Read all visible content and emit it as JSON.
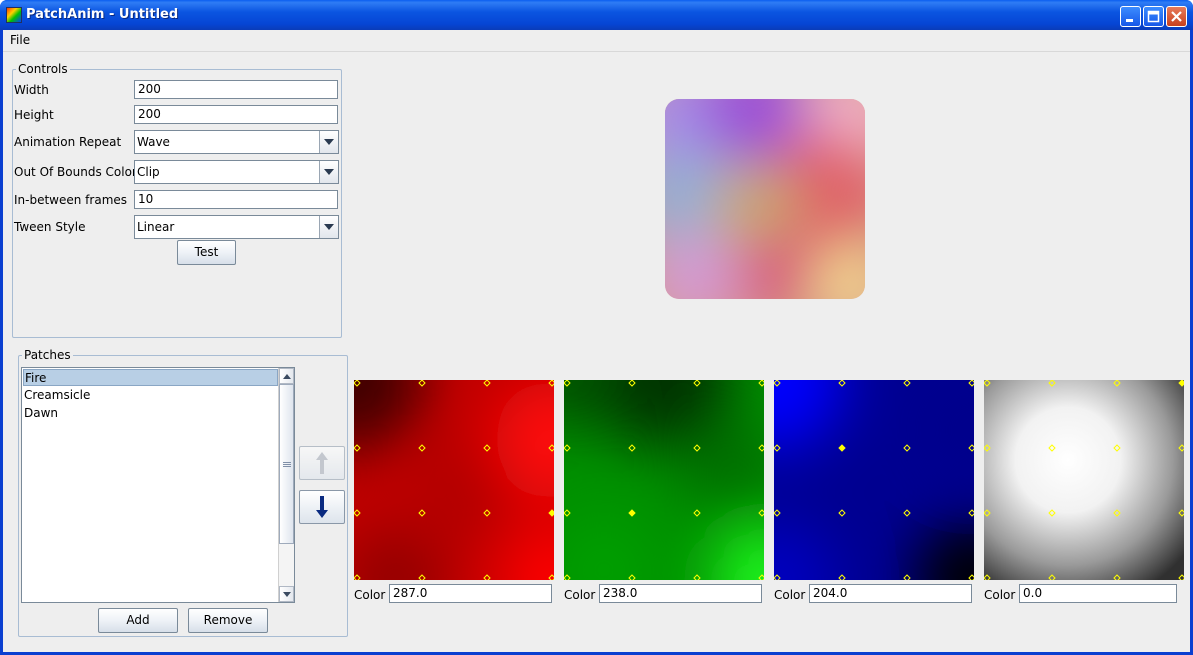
{
  "window": {
    "title": "PatchAnim - Untitled",
    "minimize_icon": "minimize-icon",
    "maximize_icon": "maximize-icon",
    "close_icon": "close-icon"
  },
  "menu": {
    "file": "File"
  },
  "controls": {
    "legend": "Controls",
    "width_label": "Width",
    "width_value": "200",
    "height_label": "Height",
    "height_value": "200",
    "animation_repeat_label": "Animation Repeat",
    "animation_repeat_value": "Wave",
    "out_of_bounds_label": "Out Of Bounds Color",
    "out_of_bounds_value": "Clip",
    "inbetween_label": "In-between frames",
    "inbetween_value": "10",
    "tween_style_label": "Tween Style",
    "tween_style_value": "Linear",
    "test_button": "Test"
  },
  "patches": {
    "legend": "Patches",
    "items": [
      {
        "label": "Fire",
        "selected": true
      },
      {
        "label": "Creamsicle",
        "selected": false
      },
      {
        "label": "Dawn",
        "selected": false
      }
    ],
    "add_button": "Add",
    "remove_button": "Remove",
    "move_up_icon": "arrow-up-icon",
    "move_down_icon": "arrow-down-icon"
  },
  "channels": [
    {
      "name": "red",
      "color_label": "Color",
      "color_value": "287.0",
      "accent": "#ff0000"
    },
    {
      "name": "green",
      "color_label": "Color",
      "color_value": "238.0",
      "accent": "#00ff00"
    },
    {
      "name": "blue",
      "color_label": "Color",
      "color_value": "204.0",
      "accent": "#0000ff"
    },
    {
      "name": "alpha",
      "color_label": "Color",
      "color_value": "0.0",
      "accent": "#ffffff"
    }
  ],
  "colors": {
    "titlebar": "#0a55e0",
    "selection": "#b8cfe5",
    "control_point": "#ffff00"
  }
}
